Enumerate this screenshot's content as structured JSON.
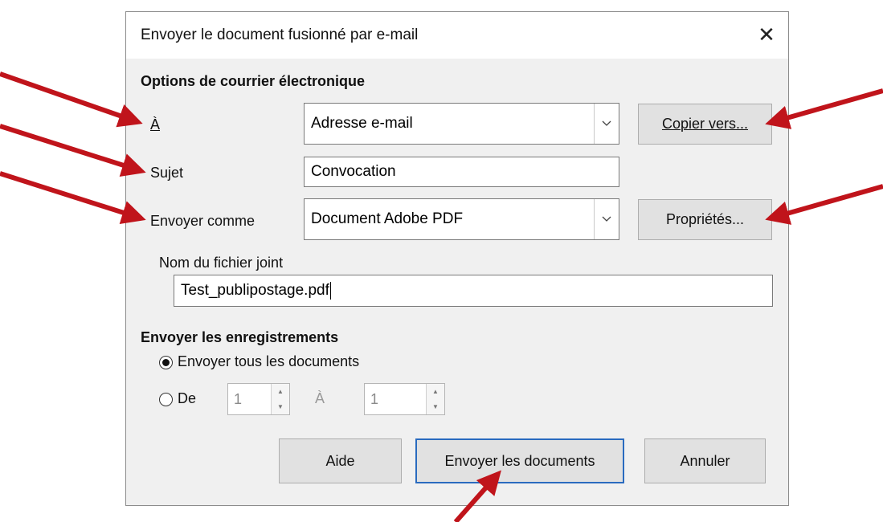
{
  "dialog": {
    "title": "Envoyer le document fusionné par e-mail",
    "close_glyph": "✕",
    "email_section": {
      "heading": "Options de courrier électronique",
      "to_label": "À",
      "to_value": "Adresse e-mail",
      "copy_to_button": "Copier vers...",
      "subject_label": "Sujet",
      "subject_value": "Convocation",
      "send_as_label": "Envoyer comme",
      "send_as_value": "Document Adobe PDF",
      "properties_button": "Propriétés...",
      "attachment_label": "Nom du fichier joint",
      "attachment_value": "Test_publipostage.pdf"
    },
    "records_section": {
      "heading": "Envoyer les enregistrements",
      "all_label": "Envoyer tous les documents",
      "all_selected": true,
      "from_label": "De",
      "from_value": "1",
      "to_label": "À",
      "to_value": "1"
    },
    "buttons": {
      "help": "Aide",
      "send": "Envoyer les documents",
      "cancel": "Annuler"
    }
  },
  "annotation_arrow_color": "#c0141b",
  "icons": [
    "close-icon",
    "chevron-down-icon",
    "spin-up-icon",
    "spin-down-icon",
    "annotation-arrow-icon"
  ]
}
